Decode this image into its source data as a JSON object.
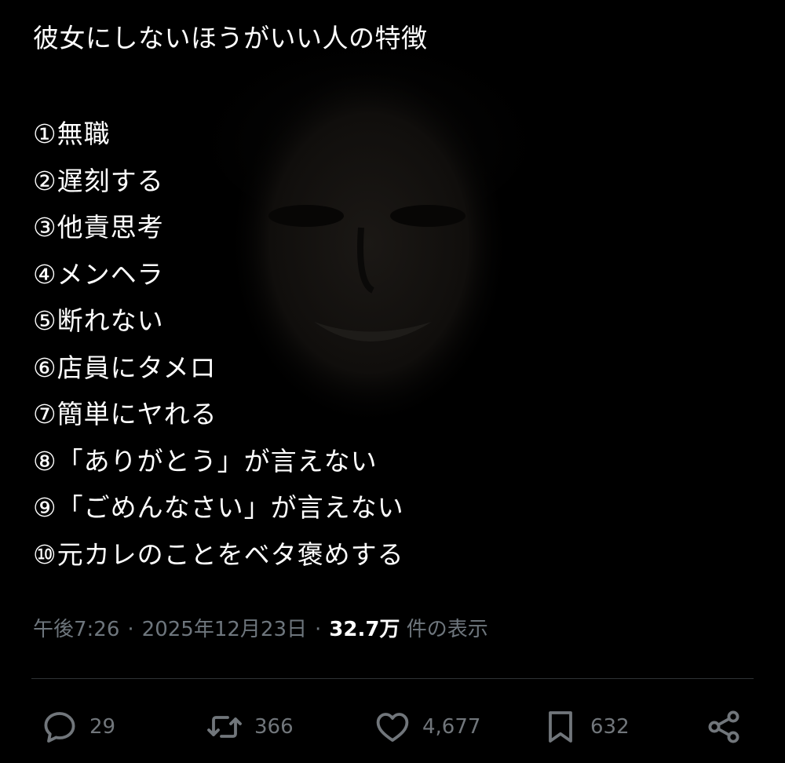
{
  "tweet": {
    "title": "彼女にしないほうがいい人の特徴",
    "items": [
      "①無職",
      "②遅刻する",
      "③他責思考",
      "④メンヘラ",
      "⑤断れない",
      "⑥店員にタメロ",
      "⑦簡単にヤれる",
      "⑧「ありがとう」が言えない",
      "⑨「ごめんなさい」が言えない",
      "⑩元カレのことをベタ褒めする"
    ]
  },
  "meta": {
    "time": "午後7:26",
    "separator": "·",
    "date": "2025年12月23日",
    "views_count": "32.7万",
    "views_label": "件の表示"
  },
  "actions": {
    "replies": "29",
    "retweets": "366",
    "likes": "4,677",
    "bookmarks": "632"
  },
  "icons": {
    "reply": "speech-bubble-icon",
    "retweet": "retweet-icon",
    "like": "heart-icon",
    "bookmark": "bookmark-icon",
    "share": "share-icon"
  },
  "colors": {
    "background": "#000000",
    "text": "#ffffff",
    "secondary": "#71767b",
    "divider": "#2f3336"
  }
}
